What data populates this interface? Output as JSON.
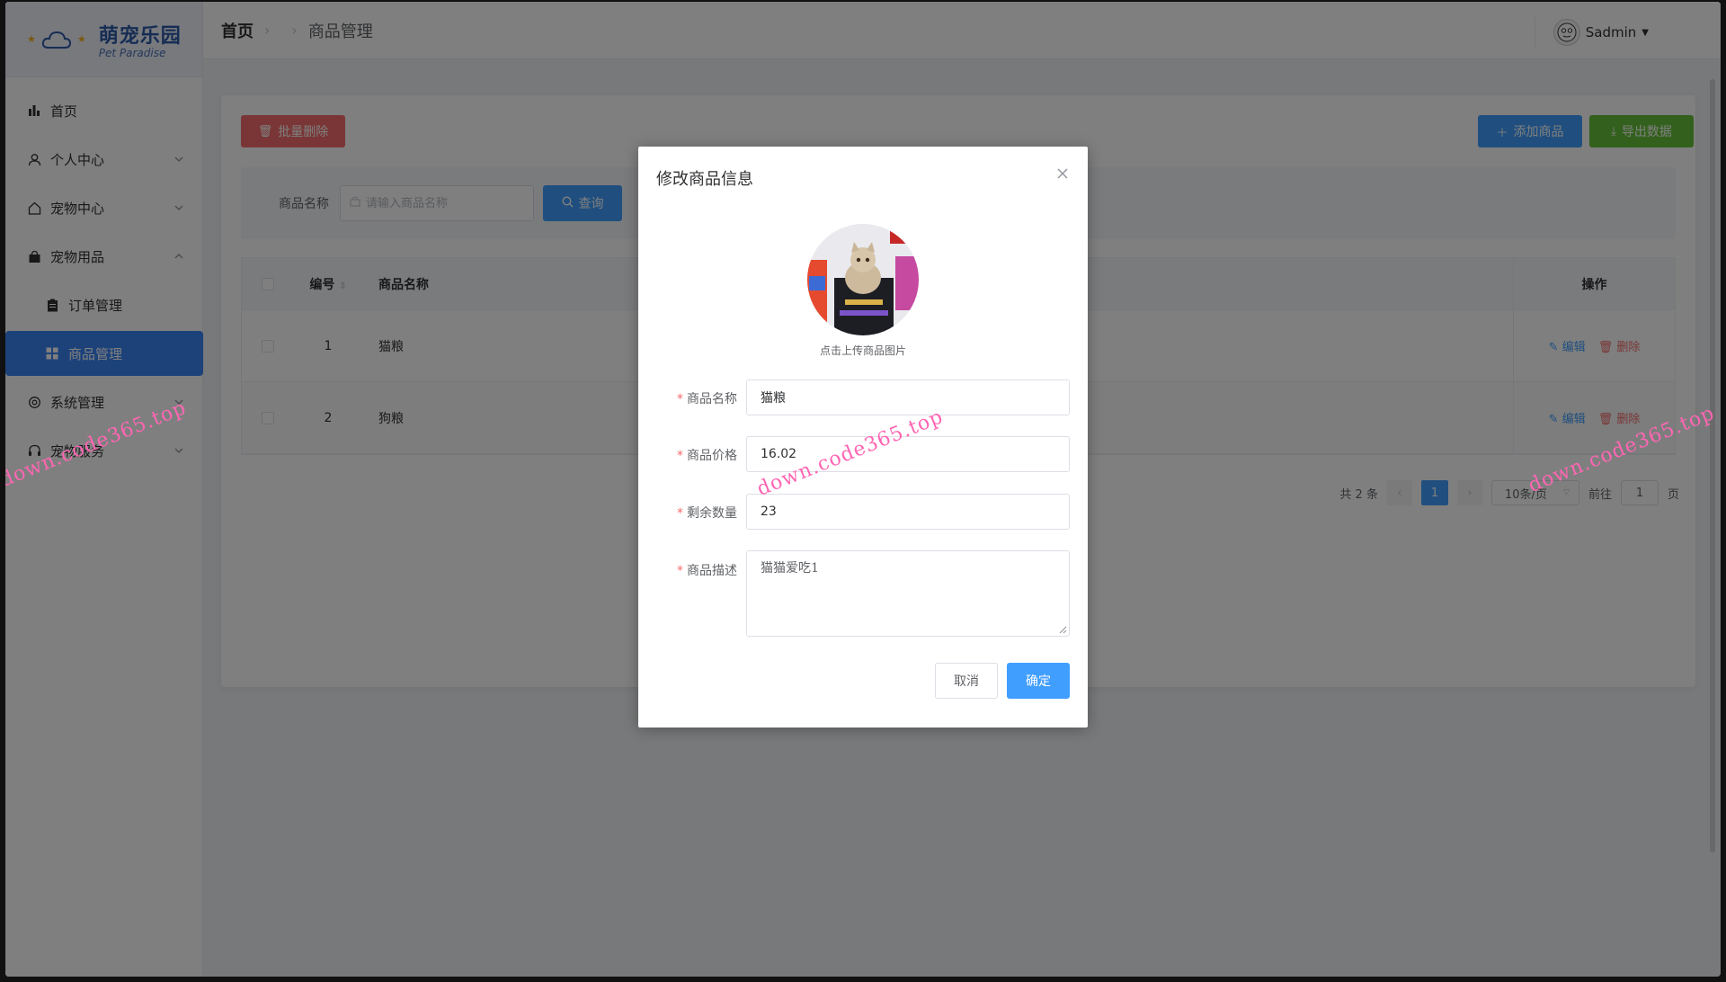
{
  "app": {
    "title": "萌宠乐园",
    "subtitle": "Pet Paradise"
  },
  "sidebar": {
    "items": [
      {
        "label": "首页",
        "icon": "bar-chart-icon"
      },
      {
        "label": "个人中心",
        "icon": "user-icon"
      },
      {
        "label": "宠物中心",
        "icon": "home-icon"
      },
      {
        "label": "宠物用品",
        "icon": "bag-icon"
      },
      {
        "label": "订单管理",
        "icon": "clipboard-icon"
      },
      {
        "label": "商品管理",
        "icon": "grid-icon"
      },
      {
        "label": "系统管理",
        "icon": "settings-icon"
      },
      {
        "label": "宠物服务",
        "icon": "headset-icon"
      }
    ]
  },
  "header": {
    "breadcrumb_home": "首页",
    "breadcrumb_current": "商品管理",
    "user_name": "Sadmin"
  },
  "toolbar": {
    "batch_delete": "批量删除",
    "add_product": "添加商品",
    "export_data": "导出数据"
  },
  "search": {
    "label": "商品名称",
    "placeholder": "请输入商品名称",
    "button": "查询"
  },
  "table": {
    "columns": [
      "编号",
      "商品名称",
      "操作"
    ],
    "rows": [
      {
        "id": "1",
        "name": "猫粮"
      },
      {
        "id": "2",
        "name": "狗粮"
      }
    ],
    "edit_label": "编辑",
    "delete_label": "删除"
  },
  "pagination": {
    "total": "共 2 条",
    "current_page": "1",
    "page_size": "10条/页",
    "goto_prefix": "前往",
    "goto_value": "1",
    "goto_suffix": "页"
  },
  "dialog": {
    "title": "修改商品信息",
    "upload_tip": "点击上传商品图片",
    "fields": {
      "name_label": "商品名称",
      "name_value": "猫粮",
      "price_label": "商品价格",
      "price_value": "16.02",
      "stock_label": "剩余数量",
      "stock_value": "23",
      "desc_label": "商品描述",
      "desc_value": "猫猫爱吃1"
    },
    "cancel": "取消",
    "confirm": "确定"
  },
  "watermark": {
    "text": "down.code365.top"
  },
  "colors": {
    "primary": "#409eff",
    "danger": "#f56c6c",
    "success": "#67c23a",
    "brand": "#2d5aa8",
    "watermark": "#ff66b3"
  }
}
